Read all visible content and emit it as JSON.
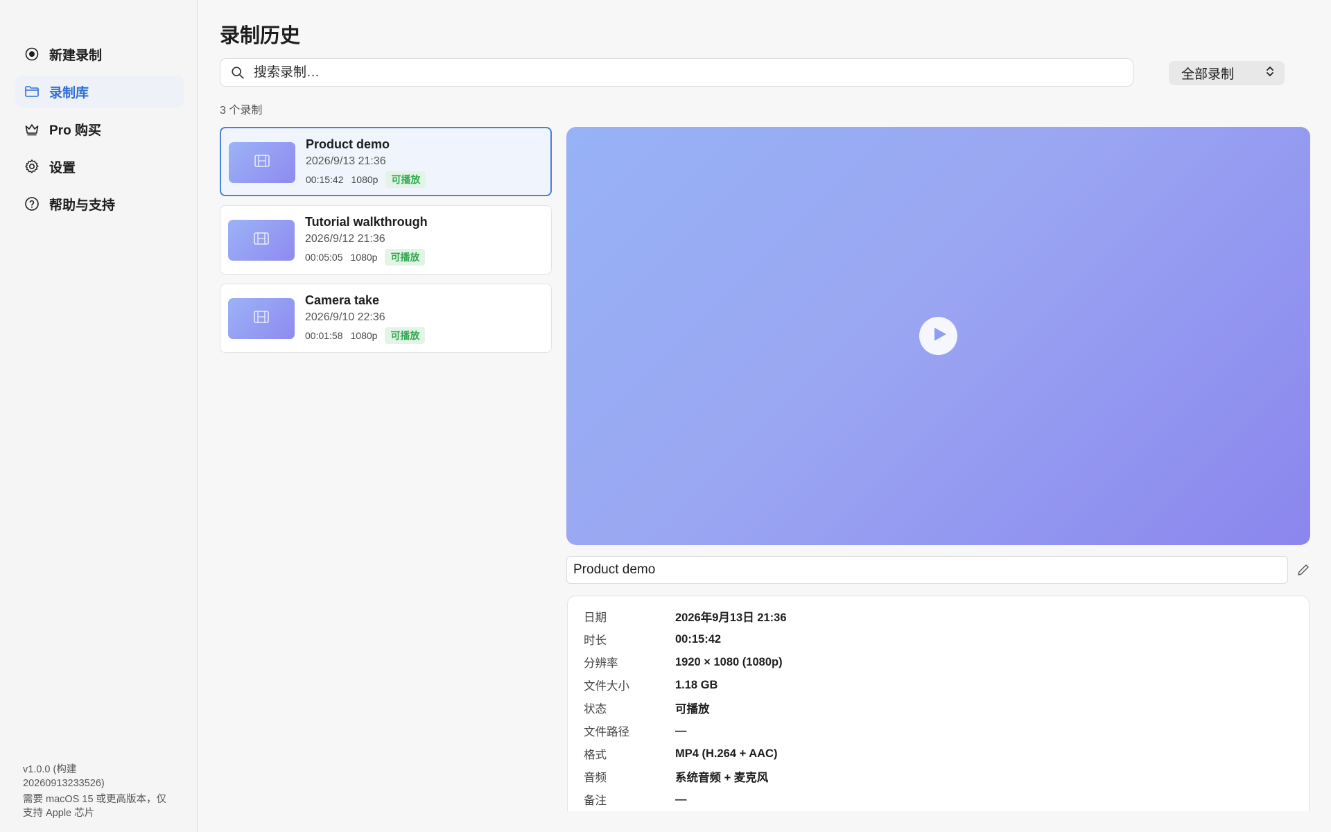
{
  "sidebar": {
    "items": [
      {
        "label": "新建录制",
        "icon": "record-icon",
        "active": false
      },
      {
        "label": "录制库",
        "icon": "folder-icon",
        "active": true
      },
      {
        "label": "Pro 购买",
        "icon": "crown-icon",
        "active": false
      },
      {
        "label": "设置",
        "icon": "gear-icon",
        "active": false
      },
      {
        "label": "帮助与支持",
        "icon": "help-icon",
        "active": false
      }
    ],
    "version_line1": "v1.0.0 (构建",
    "version_line2": "20260913233526)",
    "requirement_line1": "需要 macOS 15 或更高版本，仅",
    "requirement_line2": "支持 Apple 芯片"
  },
  "main": {
    "title": "录制历史",
    "search": {
      "placeholder": "搜索录制…",
      "value": ""
    },
    "filter": {
      "selected": "全部录制"
    },
    "count_label": "3 个录制",
    "recordings": [
      {
        "title": "Product demo",
        "date": "2026/9/13 21:36",
        "duration": "00:15:42",
        "resolution": "1080p",
        "status": "可播放"
      },
      {
        "title": "Tutorial walkthrough",
        "date": "2026/9/12 21:36",
        "duration": "00:05:05",
        "resolution": "1080p",
        "status": "可播放"
      },
      {
        "title": "Camera take",
        "date": "2026/9/10 22:36",
        "duration": "00:01:58",
        "resolution": "1080p",
        "status": "可播放"
      }
    ],
    "detail": {
      "name": "Product demo",
      "rows": [
        {
          "label": "日期",
          "value": "2026年9月13日 21:36"
        },
        {
          "label": "时长",
          "value": "00:15:42"
        },
        {
          "label": "分辨率",
          "value": "1920 × 1080 (1080p)"
        },
        {
          "label": "文件大小",
          "value": "1.18 GB"
        },
        {
          "label": "状态",
          "value": "可播放"
        },
        {
          "label": "文件路径",
          "value": "—"
        },
        {
          "label": "格式",
          "value": "MP4 (H.264 + AAC)"
        },
        {
          "label": "音频",
          "value": "系统音频 + 麦克风"
        },
        {
          "label": "备注",
          "value": "—"
        }
      ]
    }
  },
  "colors": {
    "accent": "#2f6fd6",
    "status_green": "#34a853",
    "preview_gradient_start": "#97b2f6",
    "preview_gradient_end": "#8b86ee"
  }
}
